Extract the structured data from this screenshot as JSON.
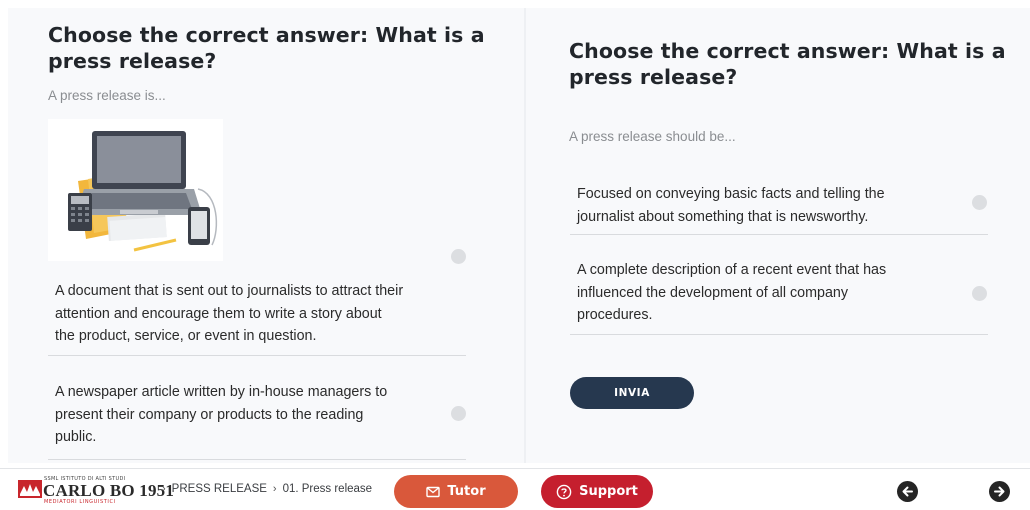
{
  "left_question": {
    "title": "Choose the correct answer: What is a press release?",
    "subtitle": "A press release is...",
    "options": [
      {
        "text": "A document that is sent out to journalists to attract their attention and encourage them to write a story about the product, service, or event in question."
      },
      {
        "text": "A newspaper article written by in-house managers to present their company or products to the reading public."
      }
    ]
  },
  "right_question": {
    "title": "Choose the correct answer: What is a press release?",
    "subtitle": "A press release should be...",
    "options": [
      {
        "text": "Focused on conveying basic facts and telling the journalist about something that is newsworthy."
      },
      {
        "text": "A complete description of a recent event that has influenced the development of all company procedures."
      }
    ],
    "submit_label": "INVIA"
  },
  "footer": {
    "logo": {
      "top_text": "SSML ISTITUTO DI ALTI STUDI",
      "main_text": "CARLO BO 1951",
      "bottom_text": "MEDIATORI LINGUISTICI"
    },
    "breadcrumb": [
      "PRESS RELEASE",
      "01. Press release"
    ],
    "tutor_label": "Tutor",
    "support_label": "Support"
  },
  "colors": {
    "submit_bg": "#26384f",
    "tutor_bg": "#d9583b",
    "support_bg": "#c51f2e"
  },
  "icons": [
    "laptop-illustration",
    "mail-icon",
    "question-circle-icon",
    "arrow-left-icon",
    "arrow-right-icon",
    "radio-icon"
  ]
}
